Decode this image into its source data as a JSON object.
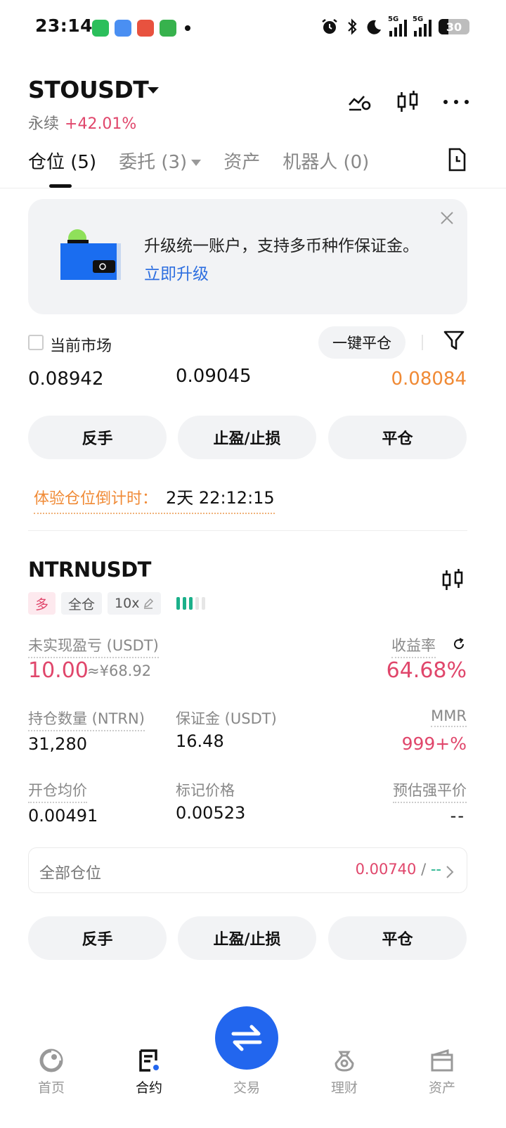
{
  "status_bar": {
    "time": "23:14",
    "battery": "30",
    "network1": "5G",
    "network2": "5G"
  },
  "header": {
    "symbol": "STOUSDT",
    "contract_type": "永续",
    "change_pct": "+42.01%"
  },
  "tabs": [
    {
      "label": "仓位 (5)"
    },
    {
      "label": "委托 (3)"
    },
    {
      "label": "资产"
    },
    {
      "label": "机器人 (0)"
    }
  ],
  "banner": {
    "text": "升级统一账户，支持多币种作保证金。",
    "link": "立即升级"
  },
  "controls": {
    "current_market_label": "当前市场",
    "close_all_label": "一键平仓"
  },
  "position1": {
    "price_a": "0.08942",
    "price_b": "0.09045",
    "price_c": "0.08084",
    "countdown_label": "体验仓位倒计时：",
    "countdown_value": "2天 22:12:15"
  },
  "actions": {
    "reverse": "反手",
    "tp_sl": "止盈/止损",
    "close": "平仓"
  },
  "position2": {
    "symbol": "NTRNUSDT",
    "side": "多",
    "margin_mode": "全仓",
    "leverage": "10x",
    "leverage_level_bars": 3,
    "unrealized_pnl_label": "未实现盈亏 (USDT)",
    "unrealized_pnl": "10.00",
    "unrealized_pnl_cny": "≈¥68.92",
    "roe_label": "收益率",
    "roe": "64.68%",
    "qty_label": "持仓数量 (NTRN)",
    "qty": "31,280",
    "margin_label": "保证金 (USDT)",
    "margin": "16.48",
    "mmr_label": "MMR",
    "mmr": "999+%",
    "entry_label": "开仓均价",
    "entry": "0.00491",
    "mark_label": "标记价格",
    "mark": "0.00523",
    "liq_label": "预估强平价",
    "liq": "--"
  },
  "all_positions": {
    "label": "全部仓位",
    "value": "0.00740",
    "sep": " / ",
    "value2": "--"
  },
  "bottom_nav": [
    {
      "label": "首页",
      "icon": "home-icon"
    },
    {
      "label": "合约",
      "icon": "contract-icon"
    },
    {
      "label": "交易",
      "icon": "swap-icon"
    },
    {
      "label": "理财",
      "icon": "earn-icon"
    },
    {
      "label": "资产",
      "icon": "wallet-icon"
    }
  ],
  "colors": {
    "red": "#e0466b",
    "green": "#1bb08a",
    "orange": "#f08a35",
    "blue": "#2266ee",
    "link": "#2e6fe0"
  }
}
